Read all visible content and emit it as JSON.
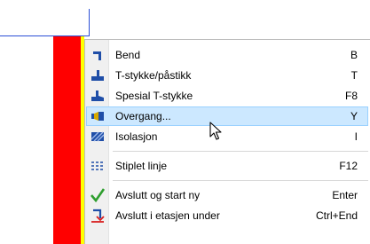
{
  "menu": {
    "items": [
      {
        "label": "Bend",
        "shortcut": "B",
        "icon": "bend-icon"
      },
      {
        "label": "T-stykke/påstikk",
        "shortcut": "T",
        "icon": "tee-icon"
      },
      {
        "label": "Spesial T-stykke",
        "shortcut": "F8",
        "icon": "special-tee-icon"
      },
      {
        "label": "Overgang...",
        "shortcut": "Y",
        "icon": "transition-icon",
        "highlighted": true
      },
      {
        "label": "Isolasjon",
        "shortcut": "I",
        "icon": "insulation-icon"
      },
      {
        "label": "Stiplet linje",
        "shortcut": "F12",
        "icon": "dashed-line-icon"
      },
      {
        "label": "Avslutt og start ny",
        "shortcut": "Enter",
        "icon": "checkmark-icon"
      },
      {
        "label": "Avslutt i etasjen under",
        "shortcut": "Ctrl+End",
        "icon": "end-below-icon"
      }
    ]
  },
  "colors": {
    "accent_blue": "#1f4ea8",
    "highlight": "#cce8ff",
    "wall_red": "#ff0000",
    "wall_yellow": "#ffff00",
    "check_green": "#2e9e2e",
    "end_red": "#d81e1e"
  }
}
